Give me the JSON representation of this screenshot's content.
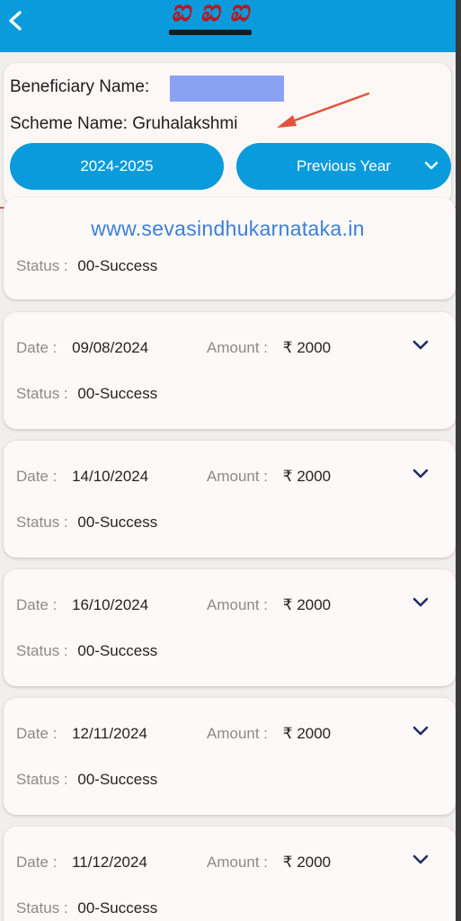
{
  "header": {
    "back_icon": "chevron-left-icon",
    "logo_text": "ಐ ಐ ಐ"
  },
  "info": {
    "beneficiary_label": "Beneficiary Name:",
    "scheme_label": "Scheme Name:",
    "scheme_value": "Gruhalakshmi",
    "year_button": "2024-2025",
    "previous_year_button": "Previous Year"
  },
  "watermark": "www.sevasindhukarnataka.in",
  "labels": {
    "date": "Date :",
    "amount": "Amount :",
    "status": "Status :"
  },
  "first_card": {
    "status": "00-Success"
  },
  "payments": [
    {
      "date": "09/08/2024",
      "amount": "₹ 2000",
      "status": "00-Success"
    },
    {
      "date": "14/10/2024",
      "amount": "₹ 2000",
      "status": "00-Success"
    },
    {
      "date": "16/10/2024",
      "amount": "₹ 2000",
      "status": "00-Success"
    },
    {
      "date": "12/11/2024",
      "amount": "₹ 2000",
      "status": "00-Success"
    },
    {
      "date": "11/12/2024",
      "amount": "₹ 2000",
      "status": "00-Success"
    }
  ],
  "colors": {
    "header": "#0a9bdc",
    "accent": "#0a9bdc",
    "divider": "#e0533a",
    "arrow": "#e0533a",
    "mask": "#8aa2f2"
  }
}
